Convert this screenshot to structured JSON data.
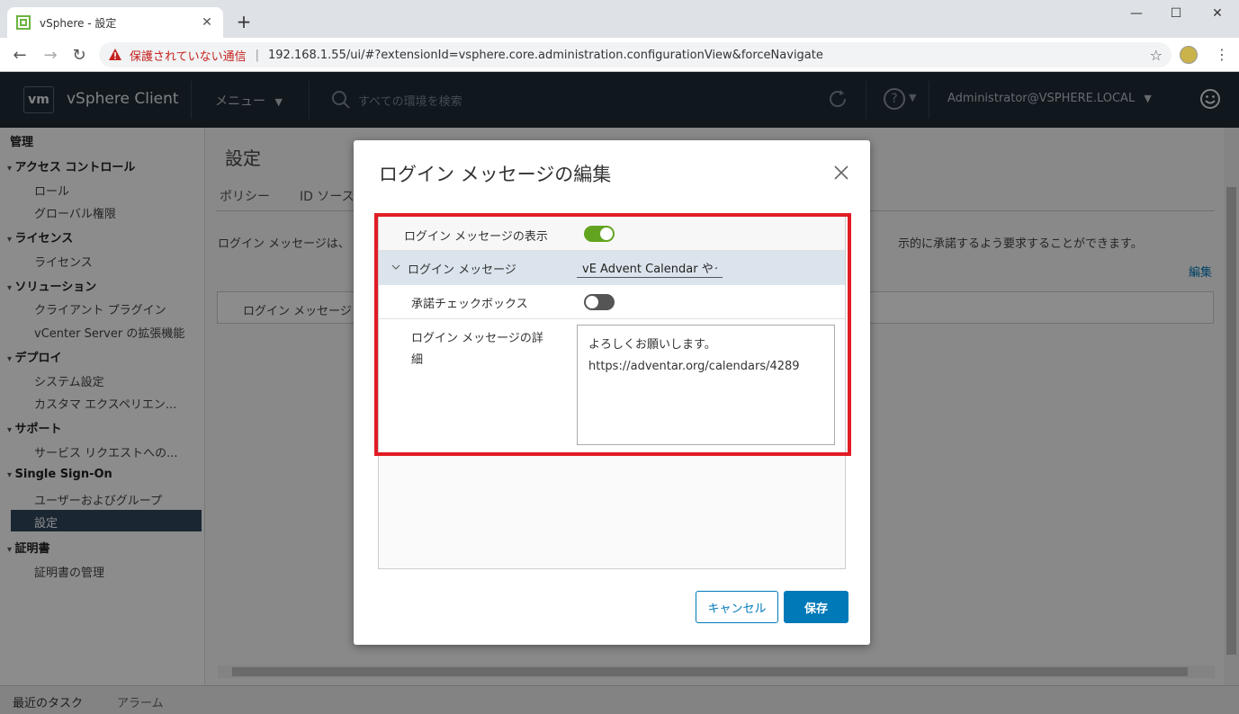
{
  "browser": {
    "tab_title": "vSphere - 設定",
    "new_tab": "+",
    "insecure_label": "保護されていない通信",
    "url": "192.168.1.55/ui/#?extensionId=vsphere.core.administration.configurationView&forceNavigate"
  },
  "header": {
    "logo": "vm",
    "app_title": "vSphere Client",
    "menu_label": "メニュー",
    "search_placeholder": "すべての環境を検索",
    "user": "Administrator@VSPHERE.LOCAL"
  },
  "sidebar": {
    "root": "管理",
    "groups": [
      {
        "label": "アクセス コントロール",
        "items": [
          "ロール",
          "グローバル権限"
        ]
      },
      {
        "label": "ライセンス",
        "items": [
          "ライセンス"
        ]
      },
      {
        "label": "ソリューション",
        "items": [
          "クライアント プラグイン",
          "vCenter Server の拡張機能"
        ]
      },
      {
        "label": "デプロイ",
        "items": [
          "システム設定",
          "カスタマ エクスペリエン..."
        ]
      },
      {
        "label": "サポート",
        "items": [
          "サービス リクエストへの..."
        ]
      },
      {
        "label": "Single Sign-On",
        "items": [
          "ユーザーおよびグループ",
          "設定"
        ]
      },
      {
        "label": "証明書",
        "items": [
          "証明書の管理"
        ]
      }
    ]
  },
  "main": {
    "title": "設定",
    "tabs": [
      "ポリシー",
      "ID ソース"
    ],
    "description_start": "ログイン メッセージは、",
    "description_end": "示的に承諾するよう要求することができます。",
    "edit_link": "編集",
    "box_label": "ログイン メッセージ"
  },
  "bottom": {
    "recent_tasks": "最近のタスク",
    "alarms": "アラーム"
  },
  "modal": {
    "title": "ログイン メッセージの編集",
    "show_message_label": "ログイン メッセージの表示",
    "show_message_on": true,
    "message_label": "ログイン メッセージ",
    "message_value": "vE Advent Calendar やっ",
    "consent_label": "承諾チェックボックス",
    "consent_on": false,
    "detail_label_line1": "ログイン メッセージの詳",
    "detail_label_line2": "細",
    "detail_line1": "よろしくお願いします。",
    "detail_line2": "https://adventar.org/calendars/4289",
    "cancel_label": "キャンセル",
    "save_label": "保存"
  },
  "colors": {
    "header_bg": "#1e2a36",
    "accent": "#0079b8",
    "toggle_on": "#62a420",
    "highlight_frame": "#e11c24",
    "sidebar_active": "#30485e"
  }
}
